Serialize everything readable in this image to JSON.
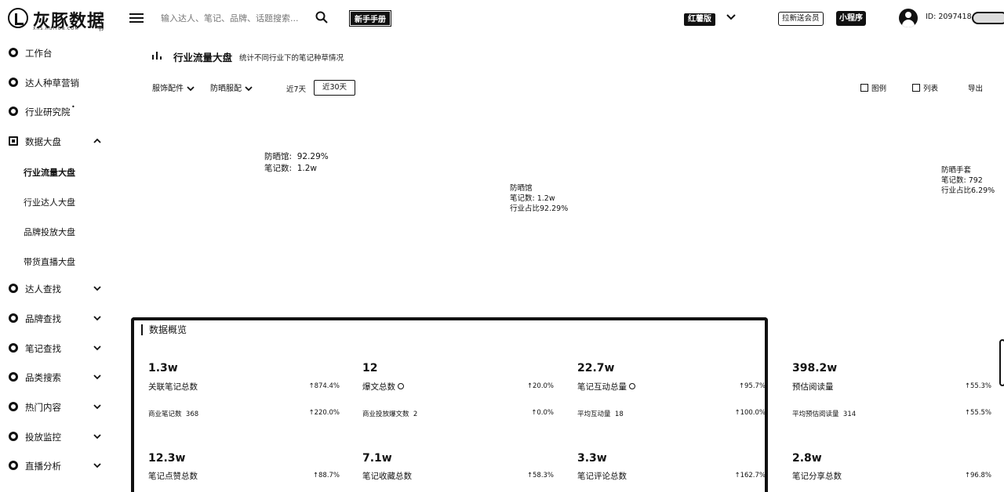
{
  "brand": {
    "name": "灰豚数据",
    "sub": "XHS.HUITUN.COM",
    "tag": "小红书"
  },
  "topbar": {
    "search_placeholder": "输入达人、笔记、品牌、话题搜索...",
    "newbie_label": "新手手册",
    "edition_label": "红薯版",
    "invite_label": "拉新送会员",
    "app_label": "小程序",
    "user_id": "ID: 2097418"
  },
  "sidebar": {
    "items": [
      {
        "label": "工作台"
      },
      {
        "label": "达人种草营销"
      },
      {
        "label": "行业研究院",
        "marker": "•"
      },
      {
        "label": "数据大盘"
      },
      {
        "label": "达人查找"
      },
      {
        "label": "品牌查找"
      },
      {
        "label": "笔记查找"
      },
      {
        "label": "品类搜索"
      },
      {
        "label": "热门内容"
      },
      {
        "label": "投放监控"
      },
      {
        "label": "直播分析"
      }
    ],
    "sub_items": [
      {
        "label": "行业流量大盘"
      },
      {
        "label": "行业达人大盘"
      },
      {
        "label": "品牌投放大盘"
      },
      {
        "label": "带货直播大盘"
      }
    ]
  },
  "page": {
    "title": "行业流量大盘",
    "subtitle": "统计不同行业下的笔记种草情况"
  },
  "filters": {
    "category": "服饰配件",
    "subcategory": "防晒服配",
    "range_7": "近7天",
    "range_30": "近30天",
    "view_chart": "图例",
    "view_list": "列表",
    "export": "导出"
  },
  "tooltips": {
    "main": {
      "name": "防晒馆:",
      "pct": "92.29%",
      "notes_label": "笔记数:",
      "notes": "1.2w"
    },
    "mid": {
      "name": "防晒馆",
      "notes": "笔记数: 1.2w",
      "share": "行业占比92.29%"
    },
    "right": {
      "name": "防晒手套",
      "notes": "笔记数: 792",
      "share": "行业占比6.29%"
    }
  },
  "overview": {
    "title": "数据概览",
    "metrics": [
      {
        "value": "1.3w",
        "label": "关联笔记总数",
        "change": "↑874.4%",
        "sub_label": "商业笔记数",
        "sub_value": "368",
        "sub_change": "↑220.0%"
      },
      {
        "value": "12",
        "label": "爆文总数",
        "change": "↑20.0%",
        "sub_label": "商业投放爆文数",
        "sub_value": "2",
        "sub_change": "↑0.0%"
      },
      {
        "value": "22.7w",
        "label": "笔记互动总量",
        "change": "↑95.7%",
        "sub_label": "平均互动量",
        "sub_value": "18",
        "sub_change": "↑100.0%"
      },
      {
        "value": "398.2w",
        "label": "预估阅读量",
        "change": "↑55.3%",
        "sub_label": "平均预估阅读量",
        "sub_value": "314",
        "sub_change": "↑55.5%"
      },
      {
        "value": "12.3w",
        "label": "笔记点赞总数",
        "change": "↑88.7%"
      },
      {
        "value": "7.1w",
        "label": "笔记收藏总数",
        "change": "↑58.3%"
      },
      {
        "value": "3.3w",
        "label": "笔记评论总数",
        "change": "↑162.7%"
      },
      {
        "value": "2.8w",
        "label": "笔记分享总数",
        "change": "↑96.8%"
      }
    ]
  }
}
